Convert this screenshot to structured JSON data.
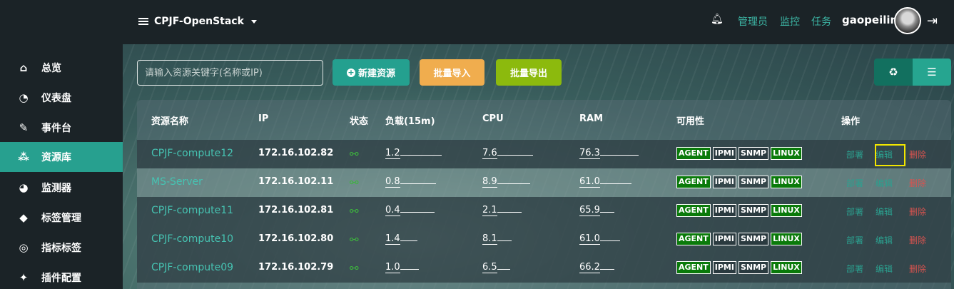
{
  "header": {
    "project": "CPJF-OpenStack",
    "nav": [
      "管理员",
      "监控",
      "任务"
    ],
    "username": "gaopeilin"
  },
  "sidebar": {
    "items": [
      {
        "label": "总览",
        "icon": "home-icon"
      },
      {
        "label": "仪表盘",
        "icon": "pie-chart-icon"
      },
      {
        "label": "事件台",
        "icon": "edit-icon"
      },
      {
        "label": "资源库",
        "icon": "cubes-icon",
        "active": true
      },
      {
        "label": "监测器",
        "icon": "dashboard-icon"
      },
      {
        "label": "标签管理",
        "icon": "tags-icon"
      },
      {
        "label": "指标标签",
        "icon": "bullseye-icon"
      },
      {
        "label": "插件配置",
        "icon": "plug-icon"
      }
    ]
  },
  "toolbar": {
    "search_placeholder": "请输入资源关键字(名称或IP)",
    "new_label": "新建资源",
    "import_label": "批量导入",
    "export_label": "批量导出"
  },
  "table": {
    "headers": [
      "资源名称",
      "IP",
      "状态",
      "负载(15m)",
      "CPU",
      "RAM",
      "可用性",
      "操作"
    ],
    "tags": [
      "AGENT",
      "IPMI",
      "SNMP",
      "LINUX"
    ],
    "actions": [
      "部署",
      "编辑",
      "删除"
    ],
    "rows": [
      {
        "name": "CPJF-compute12",
        "ip": "172.16.102.82",
        "load": "1.2",
        "cpu": "7.6",
        "ram": "76.3"
      },
      {
        "name": "MS-Server",
        "ip": "172.16.102.11",
        "load": "0.8",
        "cpu": "8.9",
        "ram": "61.0"
      },
      {
        "name": "CPJF-compute11",
        "ip": "172.16.102.81",
        "load": "0.4",
        "cpu": "2.1",
        "ram": "65.9"
      },
      {
        "name": "CPJF-compute10",
        "ip": "172.16.102.80",
        "load": "1.4",
        "cpu": "8.1",
        "ram": "61.0"
      },
      {
        "name": "CPJF-compute09",
        "ip": "172.16.102.79",
        "load": "1.0",
        "cpu": "6.5",
        "ram": "66.2"
      }
    ]
  }
}
